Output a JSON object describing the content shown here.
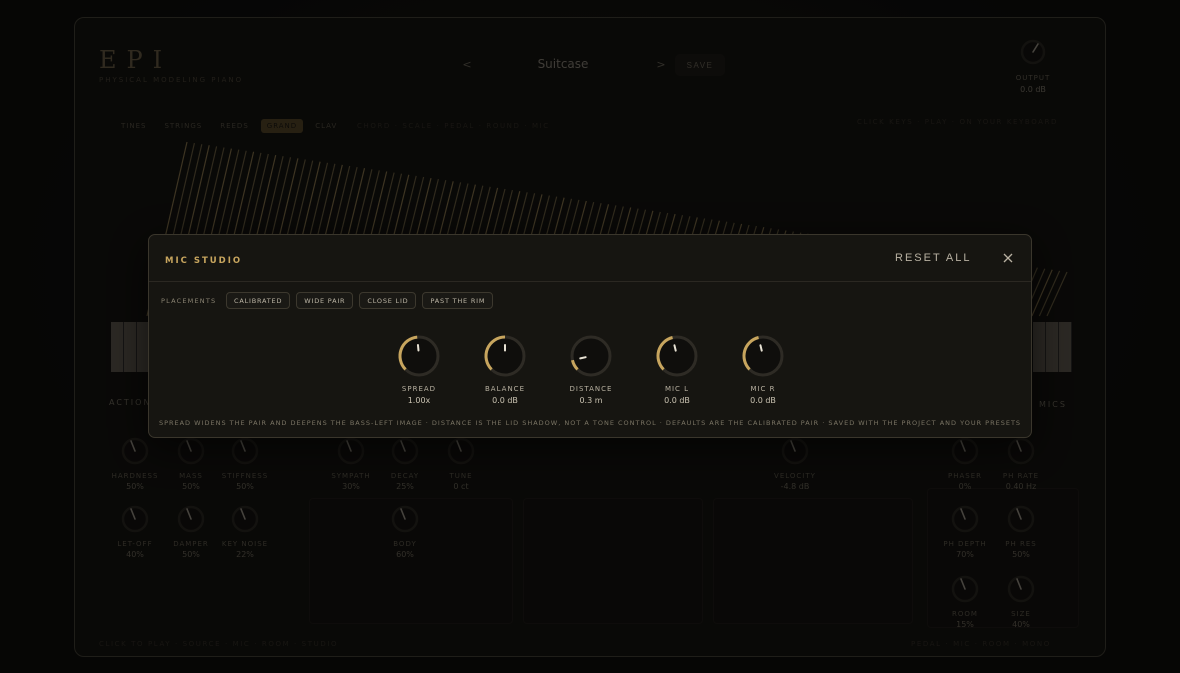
{
  "header": {
    "logo": "EPI",
    "logo_subtitle": "PHYSICAL MODELING PIANO",
    "preset_prev": "<",
    "preset_name": "Suitcase",
    "preset_next": ">",
    "save_label": "SAVE",
    "output_label": "OUTPUT",
    "output_value": "0.0 dB"
  },
  "model_tabs": [
    {
      "label": "TINES",
      "active": false
    },
    {
      "label": "STRINGS",
      "active": false
    },
    {
      "label": "REEDS",
      "active": false
    },
    {
      "label": "GRAND",
      "active": true
    },
    {
      "label": "CLAV",
      "active": false
    }
  ],
  "faded_labels": {
    "model_info": "CHORD · SCALE · PEDAL · ROUND · MIC",
    "right_info": "CLICK KEYS · PLAY · ON YOUR KEYBOARD",
    "action_header": "ACTION",
    "mics_header": "MICS",
    "bottom_left": "CLICK TO PLAY · SOURCE · MIC · ROOM · STUDIO",
    "bottom_right": "PEDAL · MIC · ROOM · MONO"
  },
  "background_knobs": [
    {
      "label": "HARDNESS",
      "value": "50%"
    },
    {
      "label": "MASS",
      "value": "50%"
    },
    {
      "label": "STIFFNESS",
      "value": "50%"
    },
    {
      "label": "LET-OFF",
      "value": "40%"
    },
    {
      "label": "DAMPER",
      "value": "50%"
    },
    {
      "label": "KEY NOISE",
      "value": "22%"
    },
    {
      "label": "SYMPATH",
      "value": "30%"
    },
    {
      "label": "DECAY",
      "value": "25%"
    },
    {
      "label": "TUNE",
      "value": "0 ct"
    },
    {
      "label": "BODY",
      "value": "60%"
    },
    {
      "label": "VELOCITY",
      "value": "-4.8 dB"
    },
    {
      "label": "PHASER",
      "value": "0%"
    },
    {
      "label": "PH RATE",
      "value": "0.40 Hz"
    },
    {
      "label": "PH DEPTH",
      "value": "70%"
    },
    {
      "label": "PH RES",
      "value": "50%"
    },
    {
      "label": "ROOM",
      "value": "15%"
    },
    {
      "label": "SIZE",
      "value": "40%"
    }
  ],
  "modal": {
    "title": "MIC STUDIO",
    "reset_label": "RESET ALL",
    "placements_label": "PLACEMENTS",
    "placements": [
      "CALIBRATED",
      "WIDE PAIR",
      "CLOSE LID",
      "PAST THE RIM"
    ],
    "knobs": [
      {
        "label": "SPREAD",
        "value": "1.00x",
        "level": 0.48
      },
      {
        "label": "BALANCE",
        "value": "0.0 dB",
        "level": 0.5
      },
      {
        "label": "DISTANCE",
        "value": "0.3 m",
        "level": 0.12
      },
      {
        "label": "MIC L",
        "value": "0.0 dB",
        "level": 0.45
      },
      {
        "label": "MIC R",
        "value": "0.0 dB",
        "level": 0.45
      }
    ],
    "footer": "SPREAD WIDENS THE PAIR AND DEEPENS THE BASS-LEFT IMAGE · DISTANCE IS THE LID SHADOW, NOT A TONE CONTROL · DEFAULTS ARE THE CALIBRATED PAIR · SAVED WITH THE PROJECT AND YOUR PRESETS"
  },
  "colors": {
    "accent": "#c7a55e",
    "knob_track": "#2e2b25",
    "knob_body": "#0f0e0c"
  }
}
